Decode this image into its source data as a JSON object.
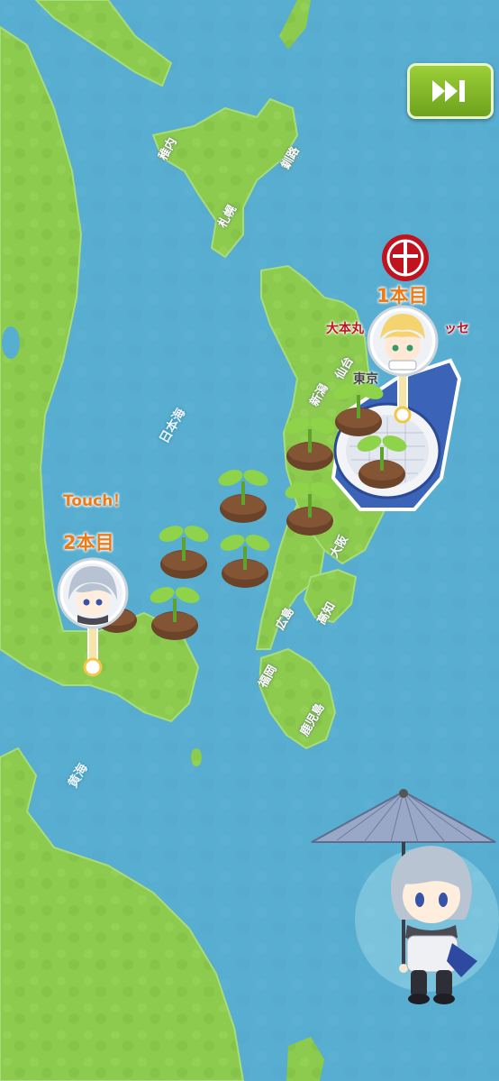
{
  "skip_button": {
    "icon": "fast-forward-icon"
  },
  "map_labels": {
    "japan_sea": "日本海",
    "yellow_sea": "黄海",
    "wakkanai": "稚内",
    "kushiro": "釧路",
    "sapporo": "札幌",
    "niigata": "新潟",
    "sendai": "仙台",
    "osaka": "大阪",
    "hiroshima": "広島",
    "kochi": "高知",
    "fukuoka": "福岡",
    "kagoshima": "鹿児島"
  },
  "venue": {
    "logo": "crest-logo",
    "count_label": "1本目",
    "name_left": "大本丸",
    "name_right": "ッセ",
    "location": "東京"
  },
  "touch_marker": {
    "touch_label": "Touch！",
    "count_label": "2本目"
  },
  "sprouts": {
    "count": 9
  },
  "characters": {
    "pin1": "character-portrait-blond",
    "pin2": "character-portrait-silver",
    "walker": "character-with-umbrella"
  },
  "colors": {
    "sea": "#58aed0",
    "land": "#8ccb4e",
    "accent_orange": "#f07a14",
    "venue_red": "#c0131f",
    "skip_green": "#7db227"
  }
}
